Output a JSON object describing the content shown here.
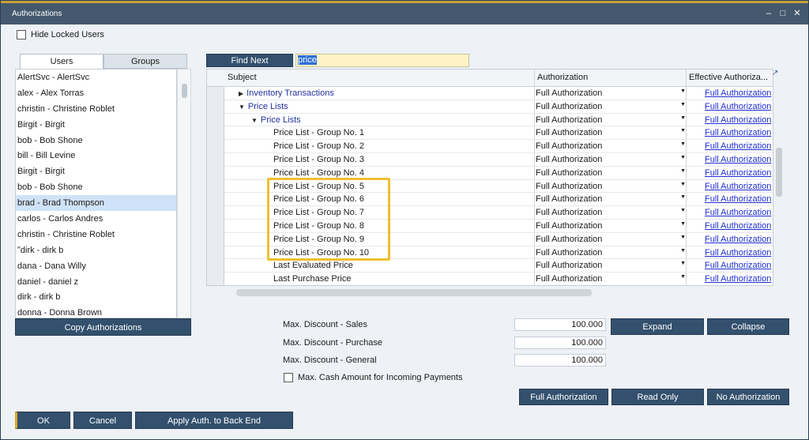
{
  "window": {
    "title": "Authorizations",
    "controls": [
      "×",
      "□",
      "✕"
    ]
  },
  "hide_locked": {
    "label": "Hide Locked Users"
  },
  "tabs": [
    {
      "label": "Users"
    },
    {
      "label": "Groups"
    }
  ],
  "users": [
    "AlertSvc - AlertSvc",
    "alex - Alex Torras",
    "christin - Christine Roblet",
    "Birgit - Birgit",
    "bob - Bob Shone",
    "bill - Bill Levine",
    "Birgit - Birgit",
    "bob - Bob Shone",
    "brad - Brad Thompson",
    "carlos - Carlos Andres",
    "christin - Christine Roblet",
    "ʺdirk - dirk b",
    "dana - Dana Willy",
    "daniel - daniel z",
    "dirk - dirk b",
    "donna - Donna Brown"
  ],
  "selected_user": "brad - Brad Thompson",
  "buttons": {
    "copy": "Copy Authorizations",
    "find_next": "Find Next",
    "expand": "Expand",
    "collapse": "Collapse",
    "full": "Full Authorization",
    "read_only": "Read Only",
    "no_auth": "No Authorization",
    "ok": "OK",
    "cancel": "Cancel",
    "apply": "Apply Auth. to Back End"
  },
  "search": {
    "value": "price"
  },
  "grid": {
    "headers": {
      "subject": "Subject",
      "authorization": "Authorization",
      "effective": "Effective Authoriza..."
    },
    "rows": [
      {
        "subject": "Inventory Transactions",
        "level": 1,
        "expander": "right",
        "authorization": "Full Authorization",
        "effective": "Full Authorization"
      },
      {
        "subject": "Price Lists",
        "level": 1,
        "expander": "down",
        "authorization": "Full Authorization",
        "effective": "Full Authorization"
      },
      {
        "subject": "Price Lists",
        "level": 2,
        "expander": "down",
        "authorization": "Full Authorization",
        "effective": "Full Authorization"
      },
      {
        "subject": "Price List - Group No. 1",
        "level": 3,
        "authorization": "Full Authorization",
        "effective": "Full Authorization"
      },
      {
        "subject": "Price List - Group No. 2",
        "level": 3,
        "authorization": "Full Authorization",
        "effective": "Full Authorization"
      },
      {
        "subject": "Price List - Group No. 3",
        "level": 3,
        "authorization": "Full Authorization",
        "effective": "Full Authorization"
      },
      {
        "subject": "Price List - Group No. 4",
        "level": 3,
        "authorization": "Full Authorization",
        "effective": "Full Authorization"
      },
      {
        "subject": "Price List - Group No. 5",
        "level": 3,
        "authorization": "Full Authorization",
        "effective": "Full Authorization"
      },
      {
        "subject": "Price List - Group No. 6",
        "level": 3,
        "authorization": "Full Authorization",
        "effective": "Full Authorization"
      },
      {
        "subject": "Price List - Group No. 7",
        "level": 3,
        "authorization": "Full Authorization",
        "effective": "Full Authorization"
      },
      {
        "subject": "Price List - Group No. 8",
        "level": 3,
        "authorization": "Full Authorization",
        "effective": "Full Authorization"
      },
      {
        "subject": "Price List - Group No. 9",
        "level": 3,
        "authorization": "Full Authorization",
        "effective": "Full Authorization"
      },
      {
        "subject": "Price List - Group No. 10",
        "level": 3,
        "authorization": "Full Authorization",
        "effective": "Full Authorization"
      },
      {
        "subject": "Last Evaluated Price",
        "level": 3,
        "authorization": "Full Authorization",
        "effective": "Full Authorization"
      },
      {
        "subject": "Last Purchase Price",
        "level": 3,
        "authorization": "Full Authorization",
        "effective": "Full Authorization"
      }
    ]
  },
  "discounts": [
    {
      "label": "Max. Discount - Sales",
      "value": "100.000"
    },
    {
      "label": "Max. Discount - Purchase",
      "value": "100.000"
    },
    {
      "label": "Max. Discount - General",
      "value": "100.000"
    }
  ],
  "cash_amount": {
    "label": "Max. Cash Amount for Incoming Payments"
  },
  "colors": {
    "accent_gold": "#f0bf2f",
    "button_blue": "#33506d",
    "link_blue": "#1f2fd1",
    "selection": "#cfe2f7"
  }
}
